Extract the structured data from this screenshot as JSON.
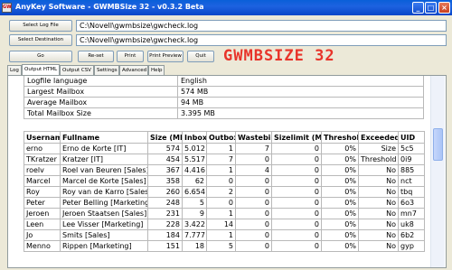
{
  "window": {
    "title": "AnyKey Software - GWMBSize 32 - v0.3.2 Beta",
    "icon_label": "GW",
    "controls": [
      "_",
      "□",
      "×"
    ]
  },
  "toolbar": {
    "select_log_label": "Select Log File",
    "select_log_value": "C:\\Novell\\gwmbsize\\gwcheck.log",
    "select_dest_label": "Select Destination",
    "select_dest_value": "C:\\Novell\\gwmbsize\\gwcheck.log",
    "go_label": "Go",
    "reset_label": "Re-set",
    "print_label": "Print",
    "preview_label": "Print Preview",
    "quit_label": "Quit"
  },
  "brand": "GWMBSIZE 32",
  "tabs": [
    "Log",
    "Output HTML",
    "Output CSV",
    "Settings",
    "Advanced",
    "Help"
  ],
  "active_tab": 1,
  "summary": [
    {
      "label": "Logfile language",
      "value": "English"
    },
    {
      "label": "Largest Mailbox",
      "value": "574 MB"
    },
    {
      "label": "Average Mailbox",
      "value": "94 MB"
    },
    {
      "label": "Total Mailbox Size",
      "value": "3.395 MB"
    }
  ],
  "grid": {
    "columns": [
      "Username",
      "Fullname",
      "Size (MB)",
      "Inbox",
      "Outbox",
      "Wastebin",
      "Sizelimit (MB)",
      "Threshold",
      "Exceeded",
      "UID"
    ],
    "rows": [
      [
        "erno",
        "Erno de Korte [IT]",
        "574",
        "5.012",
        "1",
        "7",
        "0",
        "0%",
        "Size",
        "5c5"
      ],
      [
        "TKratzer",
        "Kratzer [IT]",
        "454",
        "5.517",
        "7",
        "0",
        "0",
        "0%",
        "Threshold",
        "0i9"
      ],
      [
        "roelv",
        "Roel van Beuren [Sales]",
        "367",
        "4.416",
        "1",
        "4",
        "0",
        "0%",
        "No",
        "885"
      ],
      [
        "Marcel",
        "Marcel de Korte [Sales]",
        "358",
        "62",
        "0",
        "0",
        "0",
        "0%",
        "No",
        "nct"
      ],
      [
        "Roy",
        "Roy van de Karro [Sales]",
        "260",
        "6.654",
        "2",
        "0",
        "0",
        "0%",
        "No",
        "tbq"
      ],
      [
        "Peter",
        "Peter Belling [Marketing]",
        "248",
        "5",
        "0",
        "0",
        "0",
        "0%",
        "No",
        "6o3"
      ],
      [
        "Jeroen",
        "Jeroen Staatsen [Sales]",
        "231",
        "9",
        "1",
        "0",
        "0",
        "0%",
        "No",
        "mn7"
      ],
      [
        "Leen",
        "Lee Visser [Marketing]",
        "228",
        "3.422",
        "14",
        "0",
        "0",
        "0%",
        "No",
        "uk8"
      ],
      [
        "Jo",
        "Smits [Sales]",
        "184",
        "7.777",
        "1",
        "0",
        "0",
        "0%",
        "No",
        "6b2"
      ],
      [
        "Menno",
        "Rippen [Marketing]",
        "151",
        "18",
        "5",
        "0",
        "0",
        "0%",
        "No",
        "gyp"
      ]
    ]
  }
}
